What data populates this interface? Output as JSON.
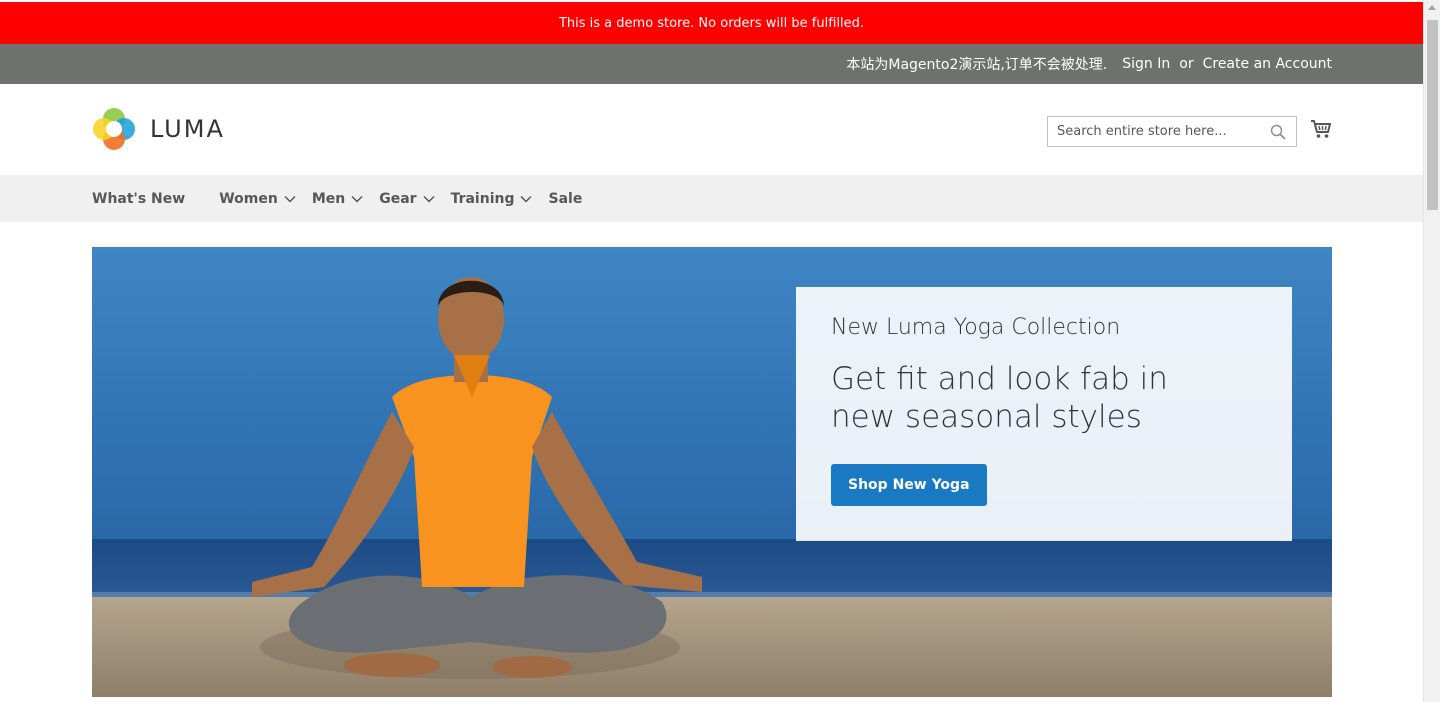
{
  "notice": {
    "text": "This is a demo store. No orders will be fulfilled."
  },
  "header_panel": {
    "welcome": "本站为Magento2演示站,订单不会被处理.",
    "sign_in": "Sign In",
    "or": "or",
    "create_account": "Create an Account"
  },
  "logo": {
    "text": "LUMA"
  },
  "search": {
    "placeholder": "Search entire store here...",
    "value": ""
  },
  "nav": {
    "items": [
      {
        "label": "What's New"
      },
      {
        "label": "Women"
      },
      {
        "label": "Men"
      },
      {
        "label": "Gear"
      },
      {
        "label": "Training"
      },
      {
        "label": "Sale"
      }
    ]
  },
  "hero": {
    "subtitle": "New Luma Yoga Collection",
    "title": "Get fit and look fab in new seasonal styles",
    "button": "Shop New Yoga"
  },
  "colors": {
    "notice_bg": "#ff0000",
    "panel_bg": "#6e716e",
    "nav_bg": "#f0f0f0",
    "accent": "#1979c3"
  },
  "icons": [
    "luma-logo-icon",
    "search-icon",
    "cart-icon",
    "chevron-down-icon"
  ]
}
